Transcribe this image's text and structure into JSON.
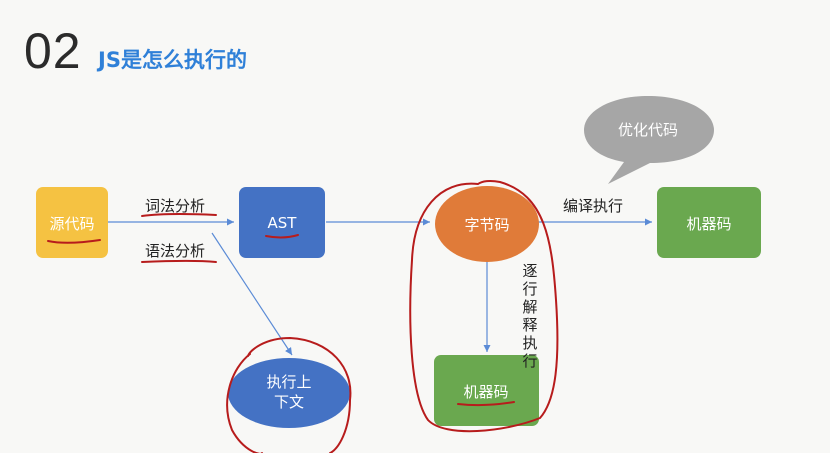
{
  "header": {
    "number": "02",
    "title": "JS是怎么执行的"
  },
  "nodes": {
    "source": "源代码",
    "ast": "AST",
    "bytecode": "字节码",
    "machine_right": "机器码",
    "machine_bottom": "机器码",
    "exec_ctx_line1": "执行上",
    "exec_ctx_line2": "下文",
    "bubble": "优化代码"
  },
  "edges": {
    "lexical": "词法分析",
    "syntax": "语法分析",
    "compile": "编译执行",
    "interpret": [
      "逐",
      "行",
      "解",
      "释",
      "执",
      "行"
    ]
  },
  "colors": {
    "source": "#f5c242",
    "ast": "#4472c4",
    "bytecode": "#e07b39",
    "machine": "#6aa84f",
    "exec": "#4472c4",
    "bubble": "#a6a6a6",
    "arrow": "#5b8bd6",
    "annotation": "#b71c1c"
  }
}
